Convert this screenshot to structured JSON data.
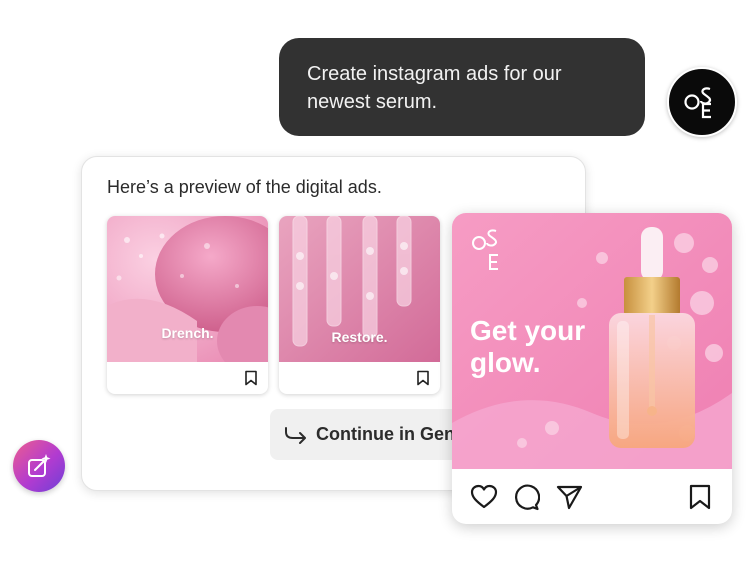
{
  "chat": {
    "user_message": "Create instagram ads for our newest serum.",
    "user_avatar_logo": "OSE",
    "assistant_message": "Here’s a preview of the digital ads."
  },
  "ads": [
    {
      "caption": "Drench.",
      "icon": "bookmark-icon"
    },
    {
      "caption": "Restore.",
      "icon": "bookmark-icon"
    }
  ],
  "continue_button": {
    "label": "Continue in GenStudio",
    "icon": "arrow-turn-right-icon"
  },
  "instagram_post": {
    "logo": "OSE",
    "headline": "Get your glow.",
    "actions": [
      "heart-icon",
      "comment-icon",
      "send-icon",
      "bookmark-icon"
    ]
  },
  "fab": {
    "icon": "sparkle-edit-icon"
  },
  "colors": {
    "user_bubble": "#323232",
    "brand_pink": "#f47eb1",
    "fab_gradient_start": "#ec5d8f",
    "fab_gradient_end": "#6e3fd6"
  }
}
